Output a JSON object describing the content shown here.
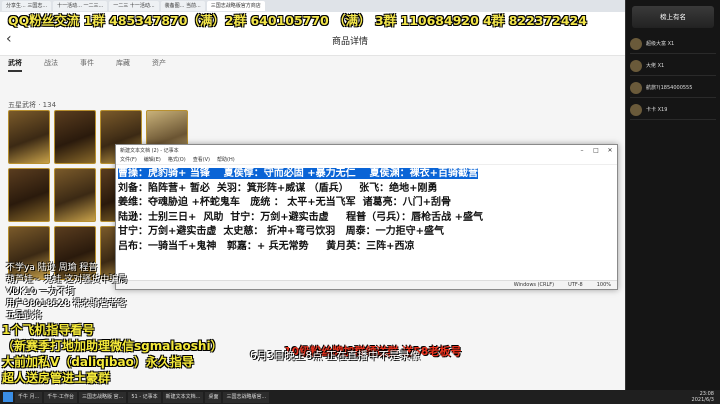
{
  "browser_tabs": [
    "分享生... 三国志...",
    "十一活动... 一二三...",
    "一二三 十一活动...",
    "装备图... 当前...",
    "三国志战略版官方商店"
  ],
  "page": {
    "title": "商品详情",
    "tabs": [
      "武将",
      "战法",
      "事件",
      "库藏",
      "资产"
    ],
    "section_title": "五星武将 · 134"
  },
  "qq_banner": "QQ粉丝交流 1群 485347870（满）2群 640105770 （满） 3群 110684920 4群 822372424",
  "notepad": {
    "title": "新建文本文档 (2) - 记事本",
    "menu": [
      "文件(F)",
      "编辑(E)",
      "格式(O)",
      "查看(V)",
      "帮助(H)"
    ],
    "lines": [
      "曹操：虎豹骑+ 当锋    夏侯惇：守而必固 +暴力无仁    夏侯渊：裸衣+百骑截营",
      "刘备：陷阵营+ 暂必  关羽：箕形阵+威谋 （盾兵）   张飞：绝地+刚勇",
      "姜维：夺魂胁迫 +杯蛇鬼车   庞统 ： 太平+无当飞军  诸葛亮：八门+刮骨",
      "陆逊：士别三日+  风助  甘宁：万剑+避实击虚     程普（弓兵）：唇枪舌战 +盛气",
      "甘宁：万剑+避实击虚  太史慈： 折冲+弯弓饮羽   周泰：一力拒守+盛气",
      "",
      "吕布：一骑当千+鬼神   郭嘉：+ 兵无常势     黄月英：三阵+西凉"
    ],
    "status": [
      "Windows (CRLF)",
      "UTF-8",
      "100%"
    ]
  },
  "overlay": {
    "chat_lines": [
      "不学ya 陆逊 周瑜 程普",
      "葫芦娃~ 鬼蛙 这对骚货中骗局",
      "VDK10 一力不打",
      "用户38018528 裸衣骑营者客",
      "五星武将"
    ],
    "promo_lines": [
      "1个飞机指导看号",
      "（新赛季打地加助理微信sgmalaoshi）",
      "大前加私V（daliqibao）永久指导",
      "超人送房管进土豪群"
    ]
  },
  "live_promo": "10级粉丝牌加群领送群 送58老板号",
  "live_note": "6月3日晚上8点 正在直播中不是录像",
  "right_panel": {
    "title": "榜上有名",
    "items": [
      "超级大富 X1",
      "大佬 X1",
      "航旅?(1854000555",
      "卡卡 X19",
      "",
      "",
      "",
      "",
      "",
      "",
      "",
      "",
      ""
    ]
  },
  "taskbar": {
    "items": [
      "千牛 月...",
      "千牛·工作台",
      "三国志战略版 官...",
      "51 - 记事本",
      "新建文本文档...",
      "桌面",
      "三国志战略版官..."
    ],
    "time": "23:08",
    "date": "2021/6/3"
  }
}
